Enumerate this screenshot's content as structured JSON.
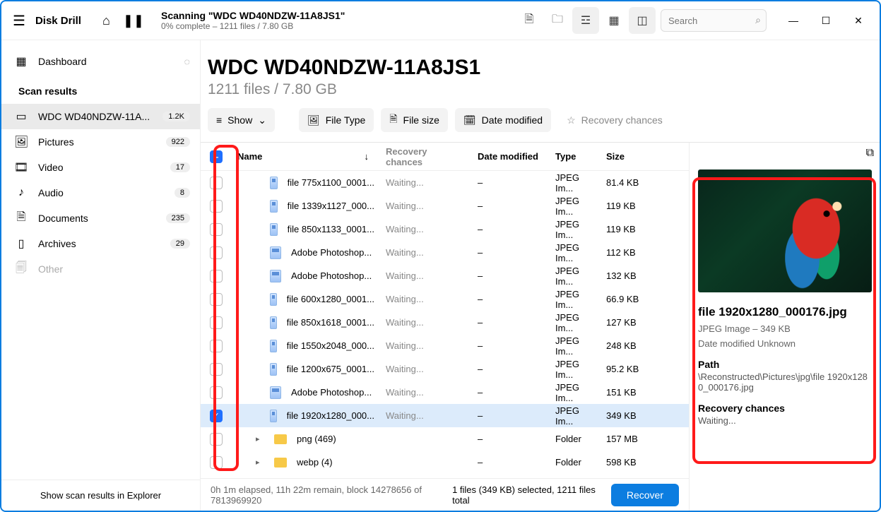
{
  "app": {
    "name": "Disk Drill"
  },
  "toolbar": {
    "scanning_title": "Scanning \"WDC WD40NDZW-11A8JS1\"",
    "scanning_sub": "0% complete – 1211 files / 7.80 GB",
    "search_placeholder": "Search"
  },
  "sidebar": {
    "dashboard": "Dashboard",
    "section": "Scan results",
    "items": [
      {
        "label": "WDC WD40NDZW-11A...",
        "badge": "1.2K"
      },
      {
        "label": "Pictures",
        "badge": "922"
      },
      {
        "label": "Video",
        "badge": "17"
      },
      {
        "label": "Audio",
        "badge": "8"
      },
      {
        "label": "Documents",
        "badge": "235"
      },
      {
        "label": "Archives",
        "badge": "29"
      },
      {
        "label": "Other",
        "badge": ""
      }
    ],
    "footer": "Show scan results in Explorer"
  },
  "header": {
    "title": "WDC WD40NDZW-11A8JS1",
    "sub": "1211 files / 7.80 GB"
  },
  "filters": {
    "show": "Show",
    "filetype": "File Type",
    "filesize": "File size",
    "datemod": "Date modified",
    "recchance": "Recovery chances"
  },
  "columns": {
    "name": "Name",
    "rec": "Recovery chances",
    "date": "Date modified",
    "type": "Type",
    "size": "Size"
  },
  "rows": [
    {
      "name": "file 775x1100_0001...",
      "rec": "Waiting...",
      "date": "–",
      "type": "JPEG Im...",
      "size": "81.4 KB",
      "kind": "file",
      "checked": false
    },
    {
      "name": "file 1339x1127_000...",
      "rec": "Waiting...",
      "date": "–",
      "type": "JPEG Im...",
      "size": "119 KB",
      "kind": "file",
      "checked": false
    },
    {
      "name": "file 850x1133_0001...",
      "rec": "Waiting...",
      "date": "–",
      "type": "JPEG Im...",
      "size": "119 KB",
      "kind": "file",
      "checked": false
    },
    {
      "name": "Adobe Photoshop...",
      "rec": "Waiting...",
      "date": "–",
      "type": "JPEG Im...",
      "size": "112 KB",
      "kind": "file",
      "checked": false
    },
    {
      "name": "Adobe Photoshop...",
      "rec": "Waiting...",
      "date": "–",
      "type": "JPEG Im...",
      "size": "132 KB",
      "kind": "file",
      "checked": false
    },
    {
      "name": "file 600x1280_0001...",
      "rec": "Waiting...",
      "date": "–",
      "type": "JPEG Im...",
      "size": "66.9 KB",
      "kind": "file",
      "checked": false
    },
    {
      "name": "file 850x1618_0001...",
      "rec": "Waiting...",
      "date": "–",
      "type": "JPEG Im...",
      "size": "127 KB",
      "kind": "file",
      "checked": false
    },
    {
      "name": "file 1550x2048_000...",
      "rec": "Waiting...",
      "date": "–",
      "type": "JPEG Im...",
      "size": "248 KB",
      "kind": "file",
      "checked": false
    },
    {
      "name": "file 1200x675_0001...",
      "rec": "Waiting...",
      "date": "–",
      "type": "JPEG Im...",
      "size": "95.2 KB",
      "kind": "file",
      "checked": false
    },
    {
      "name": "Adobe Photoshop...",
      "rec": "Waiting...",
      "date": "–",
      "type": "JPEG Im...",
      "size": "151 KB",
      "kind": "file",
      "checked": false
    },
    {
      "name": "file 1920x1280_000...",
      "rec": "Waiting...",
      "date": "–",
      "type": "JPEG Im...",
      "size": "349 KB",
      "kind": "file",
      "checked": true
    },
    {
      "name": "png (469)",
      "rec": "",
      "date": "–",
      "type": "Folder",
      "size": "157 MB",
      "kind": "folder",
      "checked": false
    },
    {
      "name": "webp (4)",
      "rec": "",
      "date": "–",
      "type": "Folder",
      "size": "598 KB",
      "kind": "folder",
      "checked": false
    }
  ],
  "preview": {
    "filename": "file 1920x1280_000176.jpg",
    "meta": "JPEG Image – 349 KB",
    "datemod": "Date modified Unknown",
    "path_label": "Path",
    "path": "\\Reconstructed\\Pictures\\jpg\\file 1920x1280_000176.jpg",
    "rec_label": "Recovery chances",
    "rec_value": "Waiting..."
  },
  "footer": {
    "status": "0h 1m elapsed, 11h 22m remain, block 14278656 of 7813969920",
    "selection": "1 files (349 KB) selected, 1211 files total",
    "recover": "Recover"
  }
}
